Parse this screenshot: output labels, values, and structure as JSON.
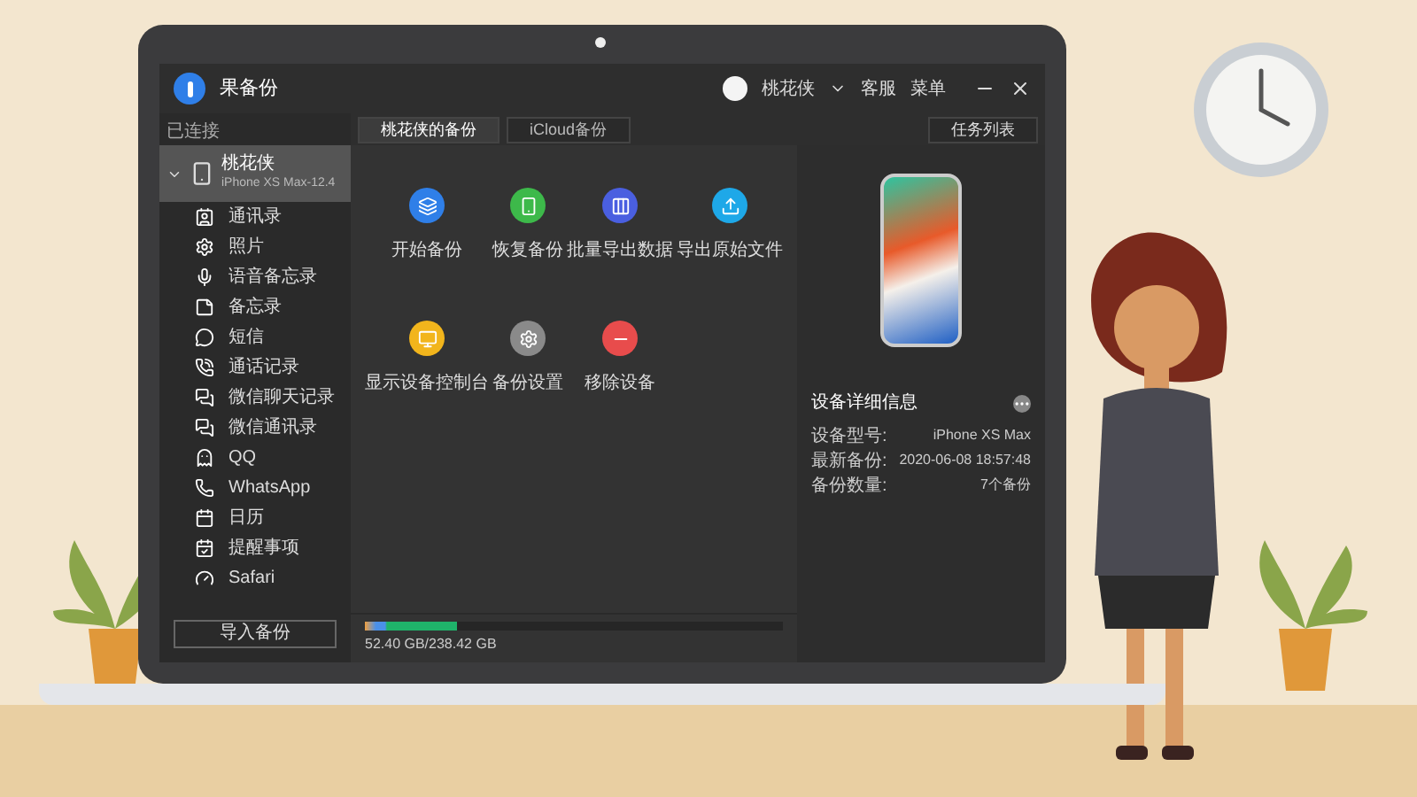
{
  "window": {
    "title": "果备份",
    "user": "桃花侠",
    "links": [
      "客服",
      "菜单"
    ]
  },
  "sidebar": {
    "section": "已连接",
    "device": {
      "name": "桃花侠",
      "model": "iPhone XS Max-12.4",
      "expanded": true,
      "selected": true
    },
    "items": [
      {
        "label": "通讯录",
        "selected": false
      },
      {
        "label": "照片",
        "selected": false
      },
      {
        "label": "语音备忘录",
        "selected": false
      },
      {
        "label": "备忘录",
        "selected": false
      },
      {
        "label": "短信",
        "selected": false
      },
      {
        "label": "通话记录",
        "selected": false
      },
      {
        "label": "微信聊天记录",
        "selected": false
      },
      {
        "label": "微信通讯录",
        "selected": false
      },
      {
        "label": "QQ",
        "selected": false
      },
      {
        "label": "WhatsApp",
        "selected": false
      },
      {
        "label": "日历",
        "selected": false
      },
      {
        "label": "提醒事项",
        "selected": false
      },
      {
        "label": "Safari",
        "selected": false
      }
    ],
    "import_button": "导入备份"
  },
  "tabs": [
    {
      "label": "桃花侠的备份",
      "selected": true
    },
    {
      "label": "iCloud备份",
      "selected": false
    }
  ],
  "task_button": "任务列表",
  "actions": [
    {
      "label": "开始备份",
      "color": "#2f7fe8"
    },
    {
      "label": "恢复备份",
      "color": "#3db94a"
    },
    {
      "label": "批量导出数据",
      "color": "#4a5fe0"
    },
    {
      "label": "导出原始文件",
      "color": "#1ea8e8"
    },
    {
      "label": "显示设备控制台",
      "color": "#f2b51c"
    },
    {
      "label": "备份设置",
      "color": "#8a8a8a"
    },
    {
      "label": "移除设备",
      "color": "#e84c4c"
    }
  ],
  "device_info": {
    "title": "设备详细信息",
    "rows": [
      {
        "label": "设备型号:",
        "value": "iPhone XS Max"
      },
      {
        "label": "最新备份:",
        "value": "2020-06-08 18:57:48"
      },
      {
        "label": "备份数量:",
        "value": "7个备份"
      }
    ]
  },
  "storage": {
    "level": 0.22,
    "reading": "52.40 GB/238.42 GB"
  }
}
